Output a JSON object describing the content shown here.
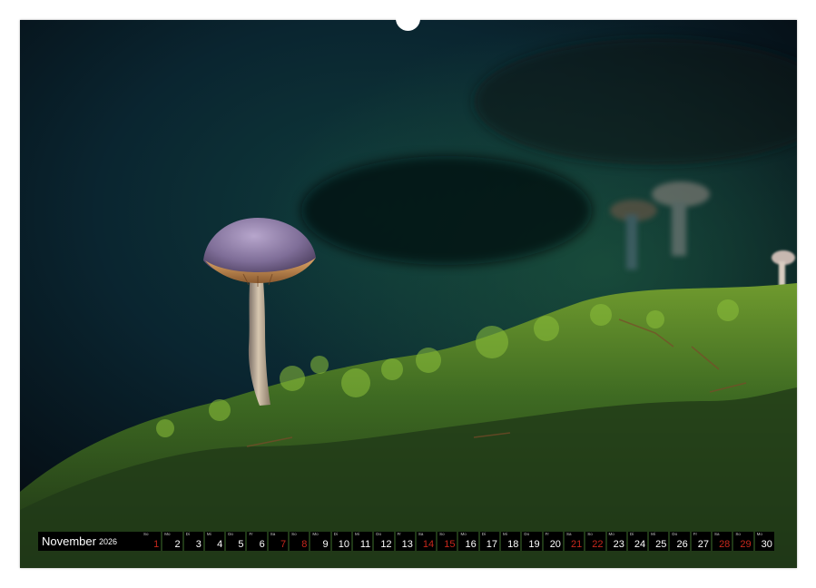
{
  "calendar": {
    "month": "November",
    "year": "2026",
    "days": [
      {
        "num": "1",
        "wd": "So",
        "weekend": "sun"
      },
      {
        "num": "2",
        "wd": "Mo",
        "weekend": ""
      },
      {
        "num": "3",
        "wd": "Di",
        "weekend": ""
      },
      {
        "num": "4",
        "wd": "Mi",
        "weekend": ""
      },
      {
        "num": "5",
        "wd": "Do",
        "weekend": ""
      },
      {
        "num": "6",
        "wd": "Fr",
        "weekend": ""
      },
      {
        "num": "7",
        "wd": "Sa",
        "weekend": "sat"
      },
      {
        "num": "8",
        "wd": "So",
        "weekend": "sun"
      },
      {
        "num": "9",
        "wd": "Mo",
        "weekend": ""
      },
      {
        "num": "10",
        "wd": "Di",
        "weekend": ""
      },
      {
        "num": "11",
        "wd": "Mi",
        "weekend": ""
      },
      {
        "num": "12",
        "wd": "Do",
        "weekend": ""
      },
      {
        "num": "13",
        "wd": "Fr",
        "weekend": ""
      },
      {
        "num": "14",
        "wd": "Sa",
        "weekend": "sat"
      },
      {
        "num": "15",
        "wd": "So",
        "weekend": "sun"
      },
      {
        "num": "16",
        "wd": "Mo",
        "weekend": ""
      },
      {
        "num": "17",
        "wd": "Di",
        "weekend": ""
      },
      {
        "num": "18",
        "wd": "Mi",
        "weekend": ""
      },
      {
        "num": "19",
        "wd": "Do",
        "weekend": ""
      },
      {
        "num": "20",
        "wd": "Fr",
        "weekend": ""
      },
      {
        "num": "21",
        "wd": "Sa",
        "weekend": "sat"
      },
      {
        "num": "22",
        "wd": "So",
        "weekend": "sun"
      },
      {
        "num": "23",
        "wd": "Mo",
        "weekend": ""
      },
      {
        "num": "24",
        "wd": "Di",
        "weekend": ""
      },
      {
        "num": "25",
        "wd": "Mi",
        "weekend": ""
      },
      {
        "num": "26",
        "wd": "Do",
        "weekend": ""
      },
      {
        "num": "27",
        "wd": "Fr",
        "weekend": ""
      },
      {
        "num": "28",
        "wd": "Sa",
        "weekend": "sat"
      },
      {
        "num": "29",
        "wd": "So",
        "weekend": "sun"
      },
      {
        "num": "30",
        "wd": "Mo",
        "weekend": ""
      }
    ]
  },
  "colors": {
    "weekend_red": "#c8281c",
    "bar_black": "#000000"
  }
}
